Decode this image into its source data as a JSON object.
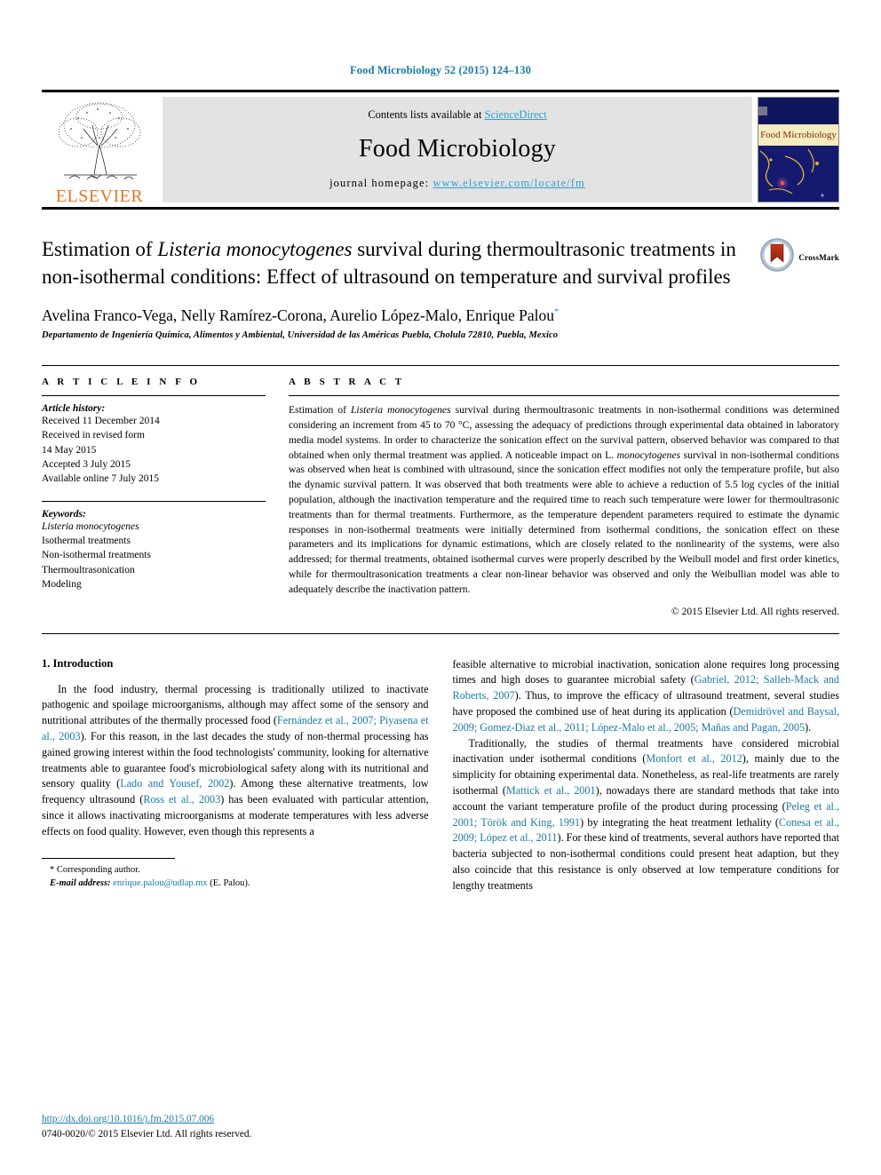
{
  "running_head": "Food Microbiology 52 (2015) 124–130",
  "masthead": {
    "contents_prefix": "Contents lists available at ",
    "contents_link": "ScienceDirect",
    "journal_title": "Food Microbiology",
    "homepage_prefix": "journal homepage: ",
    "homepage_url": "www.elsevier.com/locate/fm",
    "publisher": "ELSEVIER",
    "cover_caption": "Food Microbiology"
  },
  "title": {
    "line1_a": "Estimation of ",
    "line1_italic": "Listeria monocytogenes",
    "line1_b": " survival during thermoultrasonic treatments in non-isothermal conditions: Effect of ultrasound on temperature and survival profiles",
    "crossmark_label": "CrossMark"
  },
  "authors": "Avelina Franco-Vega, Nelly Ramírez-Corona, Aurelio López-Malo, Enrique Palou",
  "author_marker": "*",
  "affiliation": "Departamento de Ingeniería Química, Alimentos y Ambiental, Universidad de las Américas Puebla, Cholula 72810, Puebla, Mexico",
  "article_info": {
    "heading": "A R T I C L E  I N F O",
    "history_label": "Article history:",
    "history": [
      "Received 11 December 2014",
      "Received in revised form",
      "14 May 2015",
      "Accepted 3 July 2015",
      "Available online 7 July 2015"
    ],
    "keywords_label": "Keywords:",
    "keywords": [
      "Listeria monocytogenes",
      "Isothermal treatments",
      "Non-isothermal treatments",
      "Thermoultrasonication",
      "Modeling"
    ]
  },
  "abstract": {
    "heading": "A B S T R A C T",
    "part1": "Estimation of ",
    "italic1": "Listeria monocytogenes",
    "part2": " survival during thermoultrasonic treatments in non-isothermal conditions was determined considering an increment from 45 to 70 °C, assessing the adequacy of predictions through experimental data obtained in laboratory media model systems. In order to characterize the sonication effect on the survival pattern, observed behavior was compared to that obtained when only thermal treatment was applied. A noticeable impact on L. ",
    "italic2": "monocytogenes",
    "part3": " survival in non-isothermal conditions was observed when heat is combined with ultrasound, since the sonication effect modifies not only the temperature profile, but also the dynamic survival pattern. It was observed that both treatments were able to achieve a reduction of 5.5 log cycles of the initial population, although the inactivation temperature and the required time to reach such temperature were lower for thermoultrasonic treatments than for thermal treatments. Furthermore, as the temperature dependent parameters required to estimate the dynamic responses in non-isothermal treatments were initially determined from isothermal conditions, the sonication effect on these parameters and its implications for dynamic estimations, which are closely related to the nonlinearity of the systems, were also addressed; for thermal treatments, obtained isothermal curves were properly described by the Weibull model and first order kinetics, while for thermoultrasonication treatments a clear non-linear behavior was observed and only the Weibullian model was able to adequately describe the inactivation pattern.",
    "copyright": "© 2015 Elsevier Ltd. All rights reserved."
  },
  "body": {
    "section_title": "1. Introduction",
    "left_p1": {
      "t1": "In the food industry, thermal processing is traditionally utilized to inactivate pathogenic and spoilage microorganisms, although may affect some of the sensory and nutritional attributes of the thermally processed food (",
      "r1": "Fernández et al., 2007; Piyasena et al., 2003",
      "t2": "). For this reason, in the last decades the study of non-thermal processing has gained growing interest within the food technologists' community, looking for alternative treatments able to guarantee food's microbiological safety along with its nutritional and sensory quality (",
      "r2": "Lado and Yousef, 2002",
      "t3": "). Among these alternative treatments, low frequency ultrasound (",
      "r3": "Ross et al., 2003",
      "t4": ") has been evaluated with particular attention, since it allows inactivating microorganisms at moderate temperatures with less adverse effects on food quality. However, even though this represents a"
    },
    "right_p1": {
      "t1": "feasible alternative to microbial inactivation, sonication alone requires long processing times and high doses to guarantee microbial safety (",
      "r1": "Gabriel, 2012; Salleh-Mack and Roberts, 2007",
      "t2": "). Thus, to improve the efficacy of ultrasound treatment, several studies have proposed the combined use of heat during its application (",
      "r2": "Demidrövel and Baysal, 2009; Gomez-Diaz et al., 2011; López-Malo et al., 2005; Mañas and Pagan, 2005",
      "t3": ")."
    },
    "right_p2": {
      "t1": "Traditionally, the studies of thermal treatments have considered microbial inactivation under isothermal conditions (",
      "r1": "Monfort et al., 2012",
      "t2": "), mainly due to the simplicity for obtaining experimental data. Nonetheless, as real-life treatments are rarely isothermal (",
      "r2": "Mattick et al., 2001",
      "t3": "), nowadays there are standard methods that take into account the variant temperature profile of the product during processing (",
      "r3": "Peleg et al., 2001; Török and King, 1991",
      "t4": ") by integrating the heat treatment lethality (",
      "r4": "Conesa et al., 2009; López et al., 2011",
      "t5": "). For these kind of treatments, several authors have reported that bacteria subjected to non-isothermal conditions could present heat adaption, but they also coincide that this resistance is only observed at low temperature conditions for lengthy treatments"
    }
  },
  "footnote": {
    "corresponding": "* Corresponding author.",
    "email_label": "E-mail address:",
    "email": "enrique.palou@udlap.mx",
    "email_suffix": " (E. Palou)."
  },
  "doi_block": {
    "doi_url": "http://dx.doi.org/10.1016/j.fm.2015.07.006",
    "issn_line": "0740-0020/© 2015 Elsevier Ltd. All rights reserved."
  },
  "colors": {
    "link": "#1a7aa8",
    "accent": "#2aa0d4",
    "elsevier_orange": "#e87722",
    "cover_blue": "#0b1060"
  }
}
